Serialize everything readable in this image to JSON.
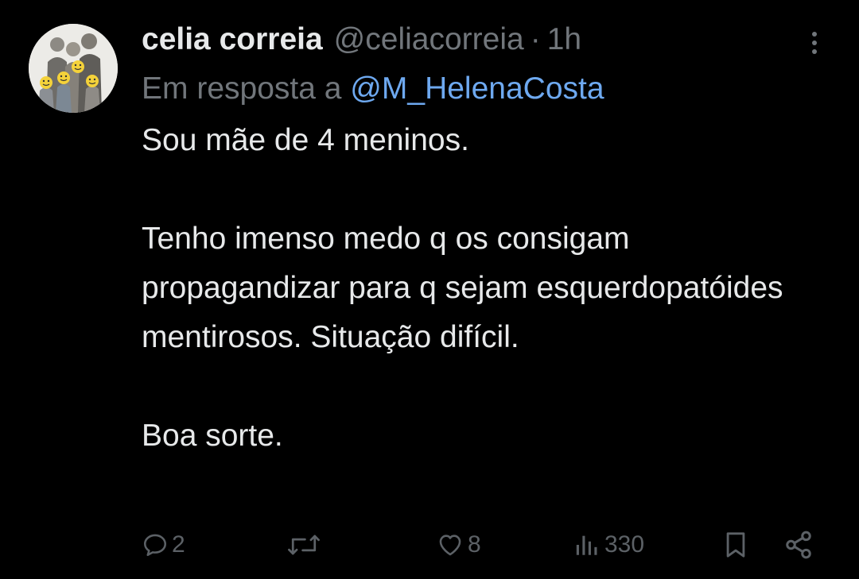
{
  "author": {
    "display_name": "celia correia",
    "handle": "@celiacorreia",
    "separator": "·",
    "time": "1h"
  },
  "reply_context": {
    "prefix": "Em resposta a",
    "mention": "@M_HelenaCosta"
  },
  "tweet": {
    "text": "Sou mãe de 4 meninos.\n\nTenho imenso medo q os consigam propagandizar para q sejam esquerdopatóides mentirosos. Situação difícil.\n\nBoa sorte."
  },
  "actions": {
    "replies": "2",
    "retweets": "",
    "likes": "8",
    "views": "330"
  },
  "icons": {
    "avatar": "family-illustration-avatar",
    "more": "more-vertical-icon",
    "reply": "reply-bubble-icon",
    "retweet": "retweet-icon",
    "like": "heart-icon",
    "views": "views-bar-chart-icon",
    "bookmark": "bookmark-icon",
    "share": "share-icon"
  },
  "colors": {
    "background": "#000000",
    "text_primary": "#e7e9ea",
    "text_secondary": "#71767b",
    "mention": "#6ea9f0",
    "action_icons": "#5c6166"
  }
}
